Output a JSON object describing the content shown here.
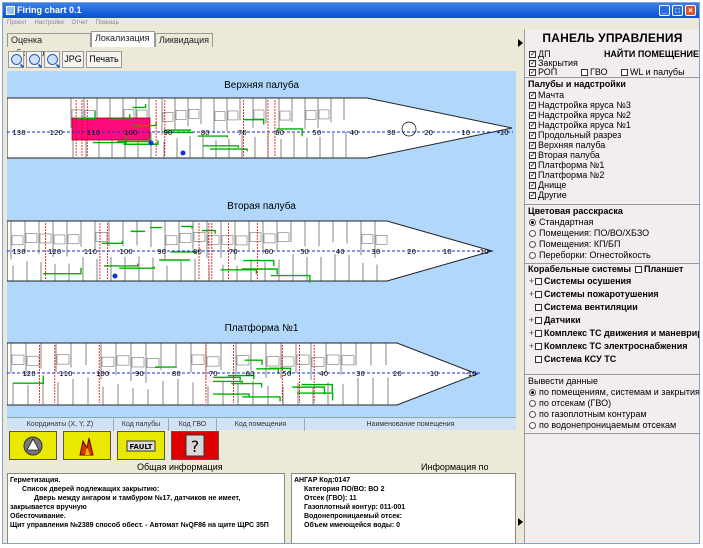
{
  "window": {
    "title": "Firing chart 0.1",
    "icon": "app-icon"
  },
  "menu": [
    "Проект",
    "Настройки",
    "Отчет",
    "Помощь"
  ],
  "tabs": [
    "Оценка обстановки",
    "Локализация",
    "Ликвидация"
  ],
  "active_tab": 1,
  "toolbar": {
    "jpg": "JPG",
    "print": "Печать",
    "icons": [
      "zoom-fit-icon",
      "zoom-in-icon",
      "zoom-out-icon"
    ]
  },
  "decks": [
    {
      "title": "Верхняя палуба",
      "ticks": [
        "130",
        "120",
        "110",
        "100",
        "90",
        "80",
        "70",
        "60",
        "50",
        "40",
        "30",
        "20",
        "10",
        "-10"
      ]
    },
    {
      "title": "Вторая палуба",
      "ticks": [
        "130",
        "120",
        "110",
        "100",
        "90",
        "80",
        "70",
        "60",
        "50",
        "40",
        "30",
        "20",
        "10",
        "-10"
      ]
    },
    {
      "title": "Платформа №1",
      "ticks": [
        "120",
        "110",
        "100",
        "90",
        "80",
        "70",
        "60",
        "50",
        "40",
        "30",
        "20",
        "10",
        "-10"
      ]
    }
  ],
  "coord_bar": [
    "Координаты (X, Y, Z)",
    "Код палубы",
    "Код ГВО",
    "Код помещения",
    "Наименование помещения"
  ],
  "action_buttons": [
    {
      "icon": "warning-triangle-icon",
      "color": "#e8e800"
    },
    {
      "icon": "fire-icon",
      "color": "#e8e800"
    },
    {
      "icon": "fault-icon",
      "label": "FAULT",
      "color": "#e8e800"
    },
    {
      "icon": "help-icon",
      "label": "?",
      "color": "#e00000"
    }
  ],
  "info": {
    "general_title": "Общая информация",
    "selected_title": "Информация по выбран",
    "general_lines": [
      "Герметизация.",
      "Список дверей подлежащих закрытию:",
      "Дверь между ангаром и тамбуром №17, датчиков не имеет,",
      "закрывается вручную",
      "Обесточивание.",
      "Щит управления №2389 способ обест. - Автомат №QF86 на щите ЩРС 35П"
    ],
    "selected_lines": [
      "АНГАР Код:0147",
      "Категория ПО/ВО: ВО 2",
      "Отсек (ГВО): 11",
      "Газоплотный контур: 011-001",
      "Водонепроницаемый отсек:",
      "Объем имеющейся воды: 0"
    ]
  },
  "panel": {
    "title": "ПАНЕЛЬ УПРАВЛЕНИЯ",
    "find_room": "НАЙТИ ПОМЕЩЕНИЕ",
    "top_checks": [
      {
        "label": "ДП",
        "checked": true
      },
      {
        "label": "Закрытия",
        "checked": true
      },
      {
        "label": "РОП",
        "checked": true
      },
      {
        "label": "ГВО",
        "checked": false
      },
      {
        "label": "WL и палубы",
        "checked": false
      }
    ],
    "decks_title": "Палубы и надстройки",
    "deck_items": [
      "Мачта",
      "Надстройка яруса №3",
      "Надстройка яруса №2",
      "Надстройка яруса №1",
      "Продольный разрез",
      "Верхняя палуба",
      "Вторая палуба",
      "Платформа №1",
      "Платформа №2",
      "Днище",
      "Другие"
    ],
    "deck_checked": [
      true,
      true,
      true,
      true,
      true,
      true,
      true,
      true,
      true,
      true,
      true
    ],
    "color_title": "Цветовая расскраска",
    "color_options": [
      "Стандартная",
      "Помещения: ПО/ВО/ХБЗО",
      "Помещения: КП/БП",
      "Переборки: Огнестойкость"
    ],
    "color_selected": 0,
    "systems_title": "Корабельные системы",
    "planshet": "Планшет",
    "systems": [
      "Системы осушения",
      "Системы пожаротушения",
      "Система вентиляции",
      "Датчики",
      "Комплекс ТС движения и маневрир",
      "Комплекс ТС электроснабжения",
      "Система КСУ ТС"
    ],
    "output_title": "Вывести данные",
    "output_options": [
      "по помещениям, системам и закрытиям",
      "по отсекам (ГВО)",
      "по газоплотным контурам",
      "по водонепроницаемым отсекам"
    ],
    "output_selected": 0
  }
}
